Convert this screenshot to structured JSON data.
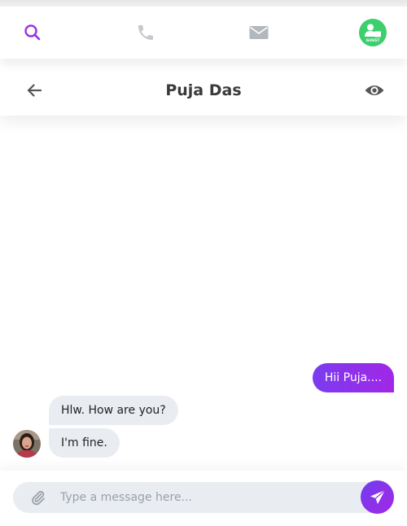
{
  "nav": {
    "items": [
      {
        "icon": "search-icon",
        "color": "#9b30e0"
      },
      {
        "icon": "phone-icon",
        "color": "#c4c8cf"
      },
      {
        "icon": "mail-icon",
        "color": "#b3b7be"
      },
      {
        "icon": "guest-avatar-icon",
        "color": "#3ccf6e",
        "badge_text": "GUEST"
      }
    ]
  },
  "chat": {
    "title": "Puja Das",
    "back_icon": "arrow-left-icon",
    "view_icon": "eye-icon"
  },
  "messages": [
    {
      "direction": "outgoing",
      "text": "Hii Puja...."
    },
    {
      "direction": "incoming",
      "text": "Hlw. How are you?"
    },
    {
      "direction": "incoming",
      "text": "I'm fine."
    }
  ],
  "composer": {
    "placeholder": "Type a message here...",
    "value": "",
    "attach_icon": "paperclip-icon",
    "send_icon": "send-icon"
  },
  "colors": {
    "accent": "#8a2be2",
    "bubble_incoming": "#e9edf2",
    "bubble_outgoing_start": "#7b3cf0",
    "bubble_outgoing_end": "#a127e6",
    "title": "#3a3a3a"
  }
}
